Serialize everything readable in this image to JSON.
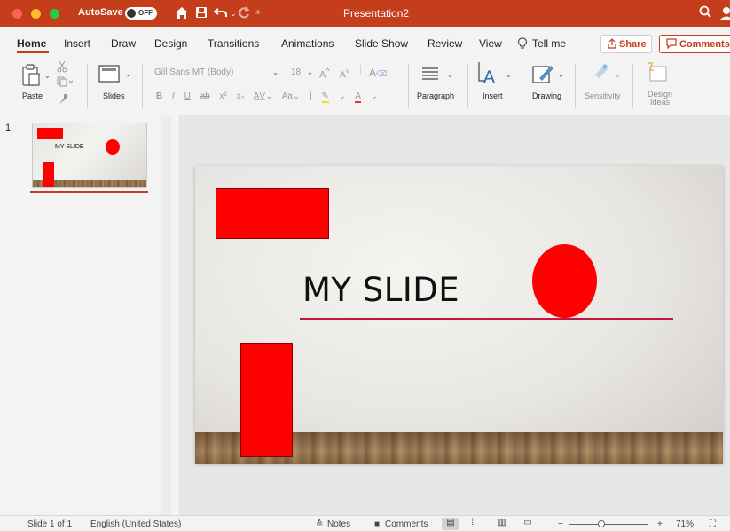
{
  "titlebar": {
    "autosave_label": "AutoSave",
    "autosave_state": "OFF",
    "doc_title": "Presentation2",
    "accent": "#c43e1c"
  },
  "tabs": [
    {
      "label": "Home",
      "active": true
    },
    {
      "label": "Insert"
    },
    {
      "label": "Draw"
    },
    {
      "label": "Design"
    },
    {
      "label": "Transitions"
    },
    {
      "label": "Animations"
    },
    {
      "label": "Slide Show"
    },
    {
      "label": "Review"
    },
    {
      "label": "View"
    },
    {
      "label": "Tell me"
    }
  ],
  "share_label": "Share",
  "comments_label": "Comments",
  "ribbon": {
    "paste": "Paste",
    "slides": "Slides",
    "font_name": "Gill Sans MT (Body)",
    "font_size": "18",
    "paragraph": "Paragraph",
    "insert": "Insert",
    "drawing": "Drawing",
    "sensitivity": "Sensitivity",
    "design_ideas": "Design Ideas"
  },
  "thumbnail": {
    "number": "1",
    "title": "MY SLIDE"
  },
  "slide": {
    "title": "MY SLIDE",
    "shape_color": "#ff0000",
    "line_color": "#c4163d"
  },
  "statusbar": {
    "slide_info": "Slide 1 of 1",
    "language": "English (United States)",
    "notes": "Notes",
    "comments": "Comments",
    "zoom": "71%"
  }
}
